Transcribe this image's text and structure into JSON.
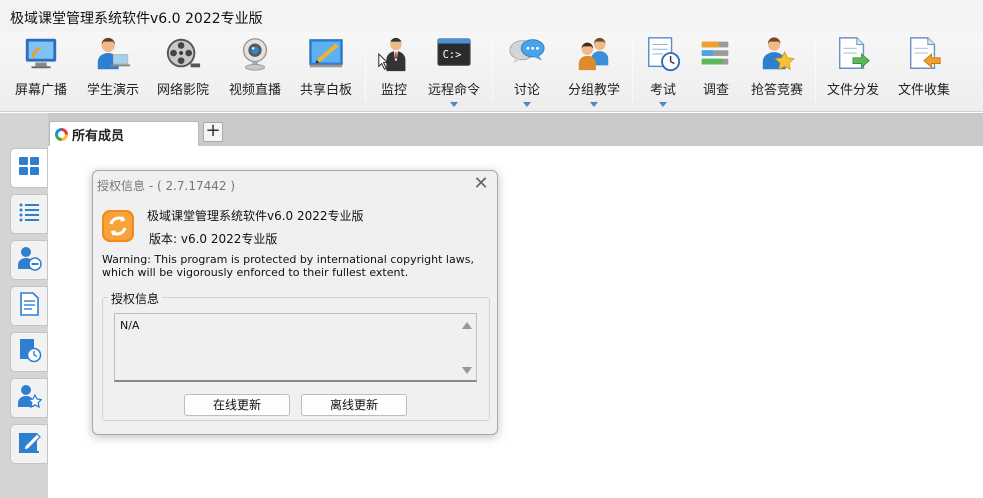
{
  "window": {
    "title": "极域课堂管理系统软件v6.0 2022专业版"
  },
  "toolbar": {
    "items": [
      {
        "label": "屏幕广播",
        "icon": "screen-broadcast-icon"
      },
      {
        "label": "学生演示",
        "icon": "student-demo-icon"
      },
      {
        "label": "网络影院",
        "icon": "film-reel-icon"
      },
      {
        "label": "视频直播",
        "icon": "webcam-icon"
      },
      {
        "label": "共享白板",
        "icon": "whiteboard-icon"
      },
      {
        "label": "监控",
        "icon": "monitor-person-icon"
      },
      {
        "label": "远程命令",
        "icon": "terminal-icon"
      },
      {
        "label": "讨论",
        "icon": "chat-bubbles-icon"
      },
      {
        "label": "分组教学",
        "icon": "group-people-icon"
      },
      {
        "label": "考试",
        "icon": "exam-clock-icon"
      },
      {
        "label": "调查",
        "icon": "survey-bars-icon"
      },
      {
        "label": "抢答竞赛",
        "icon": "quiz-star-icon"
      },
      {
        "label": "文件分发",
        "icon": "file-send-icon"
      },
      {
        "label": "文件收集",
        "icon": "file-collect-icon"
      }
    ]
  },
  "tabs": {
    "active": "所有成员",
    "add_symbol": "+"
  },
  "sidebar": {
    "items": [
      "grid-view-icon",
      "list-view-icon",
      "user-remove-icon",
      "document-icon",
      "document-clock-icon",
      "user-star-icon",
      "edit-note-icon"
    ]
  },
  "dialog": {
    "title": "授权信息 - ( 2.7.17442 )",
    "close": "✕",
    "product_name": "极域课堂管理系统软件v6.0 2022专业版",
    "version": "版本: v6.0 2022专业版",
    "warning": "Warning: This program is protected by international copyright laws, which will be vigorously enforced to their fullest extent.",
    "group_label": "授权信息",
    "license_value": "N/A",
    "online_update": "在线更新",
    "offline_update": "离线更新"
  }
}
